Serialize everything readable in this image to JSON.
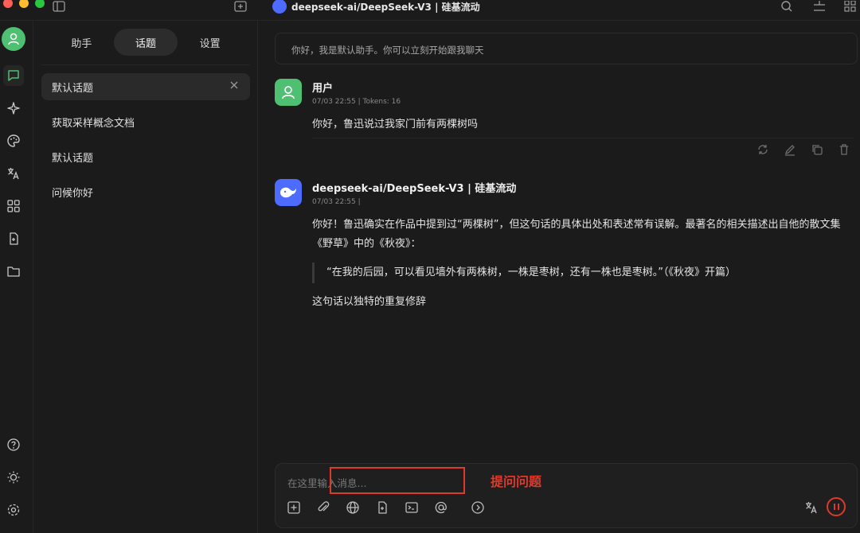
{
  "window": {
    "title": "deepseek-ai/DeepSeek-V3 | 硅基流动"
  },
  "sidebar": {
    "tabs": [
      {
        "label": "助手"
      },
      {
        "label": "话题"
      },
      {
        "label": "设置"
      }
    ],
    "active_tab": "话题",
    "topics": [
      {
        "label": "默认话题"
      },
      {
        "label": "获取采样概念文档"
      },
      {
        "label": "默认话题"
      },
      {
        "label": "问候你好"
      }
    ]
  },
  "chat": {
    "greeting": "你好，我是默认助手。你可以立刻开始跟我聊天",
    "user_message": {
      "name": "用户",
      "meta": "07/03 22:55  |  Tokens: 16",
      "text": "你好，鲁迅说过我家门前有两棵树吗"
    },
    "assistant_message": {
      "name": "deepseek-ai/DeepSeek-V3 | 硅基流动",
      "meta": "07/03 22:55  |",
      "paragraph1": "你好！鲁迅确实在作品中提到过“两棵树”，但这句话的具体出处和表述常有误解。最著名的相关描述出自他的散文集《野草》中的《秋夜》：",
      "quote": "“在我的后园，可以看见墙外有两株树，一株是枣树，还有一株也是枣树。”（《秋夜》开篇）",
      "paragraph2": "这句话以独特的重复修辞"
    }
  },
  "input": {
    "placeholder": "在这里输入消息...",
    "annotation": "提问问题"
  },
  "colors": {
    "accent_green": "#4fbf72",
    "deepseek_blue": "#4d6bfe",
    "annotation_red": "#e0392b"
  }
}
